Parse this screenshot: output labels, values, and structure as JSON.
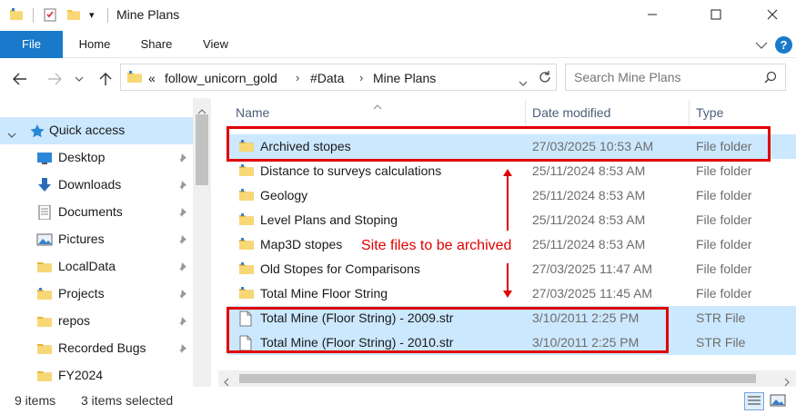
{
  "window": {
    "title": "Mine Plans",
    "minimize_glyph": "—",
    "maximize_glyph": "☐",
    "close_glyph": "✕"
  },
  "quick_access_toolbar": {
    "dropdown_glyph": "▾"
  },
  "ribbon": {
    "tabs": [
      "File",
      "Home",
      "Share",
      "View"
    ],
    "help_glyph": "?"
  },
  "address": {
    "overflow_glyph": "«",
    "crumbs": [
      "follow_unicorn_gold",
      "#Data",
      "Mine Plans"
    ],
    "separator": "›"
  },
  "search": {
    "placeholder": "Search Mine Plans"
  },
  "sidebar": {
    "items": [
      {
        "label": "Quick access",
        "icon": "star-icon"
      },
      {
        "label": "Desktop",
        "icon": "desktop-icon"
      },
      {
        "label": "Downloads",
        "icon": "download-icon"
      },
      {
        "label": "Documents",
        "icon": "documents-icon"
      },
      {
        "label": "Pictures",
        "icon": "pictures-icon"
      },
      {
        "label": "LocalData",
        "icon": "folder-icon"
      },
      {
        "label": "Projects",
        "icon": "folder-icon"
      },
      {
        "label": "repos",
        "icon": "folder-icon"
      },
      {
        "label": "Recorded Bugs",
        "icon": "folder-icon"
      },
      {
        "label": "FY2024",
        "icon": "folder-icon"
      }
    ]
  },
  "file_list": {
    "columns": [
      "Name",
      "Date modified",
      "Type"
    ],
    "rows": [
      {
        "name": "Archived stopes",
        "date": "27/03/2025 10:53 AM",
        "type": "File folder",
        "selected": true,
        "kind": "folder"
      },
      {
        "name": "Distance to surveys calculations",
        "date": "25/11/2024 8:53 AM",
        "type": "File folder",
        "selected": false,
        "kind": "folder"
      },
      {
        "name": "Geology",
        "date": "25/11/2024 8:53 AM",
        "type": "File folder",
        "selected": false,
        "kind": "folder"
      },
      {
        "name": "Level Plans and Stoping",
        "date": "25/11/2024 8:53 AM",
        "type": "File folder",
        "selected": false,
        "kind": "folder"
      },
      {
        "name": "Map3D stopes",
        "date": "25/11/2024 8:53 AM",
        "type": "File folder",
        "selected": false,
        "kind": "folder"
      },
      {
        "name": "Old Stopes for Comparisons",
        "date": "27/03/2025 11:47 AM",
        "type": "File folder",
        "selected": false,
        "kind": "folder"
      },
      {
        "name": "Total Mine Floor String",
        "date": "27/03/2025 11:45 AM",
        "type": "File folder",
        "selected": false,
        "kind": "folder"
      },
      {
        "name": "Total Mine (Floor String) - 2009.str",
        "date": "3/10/2011 2:25 PM",
        "type": "STR File",
        "selected": true,
        "kind": "file"
      },
      {
        "name": "Total Mine (Floor String) - 2010.str",
        "date": "3/10/2011 2:25 PM",
        "type": "STR File",
        "selected": true,
        "kind": "file"
      }
    ]
  },
  "annotation": {
    "text": "Site files to be archived",
    "color": "#e00000"
  },
  "status": {
    "item_count": "9 items",
    "selected_count": "3 items selected"
  },
  "colors": {
    "accent": "#1979ca",
    "selection": "#cce8ff",
    "folder": "#f4c542"
  }
}
